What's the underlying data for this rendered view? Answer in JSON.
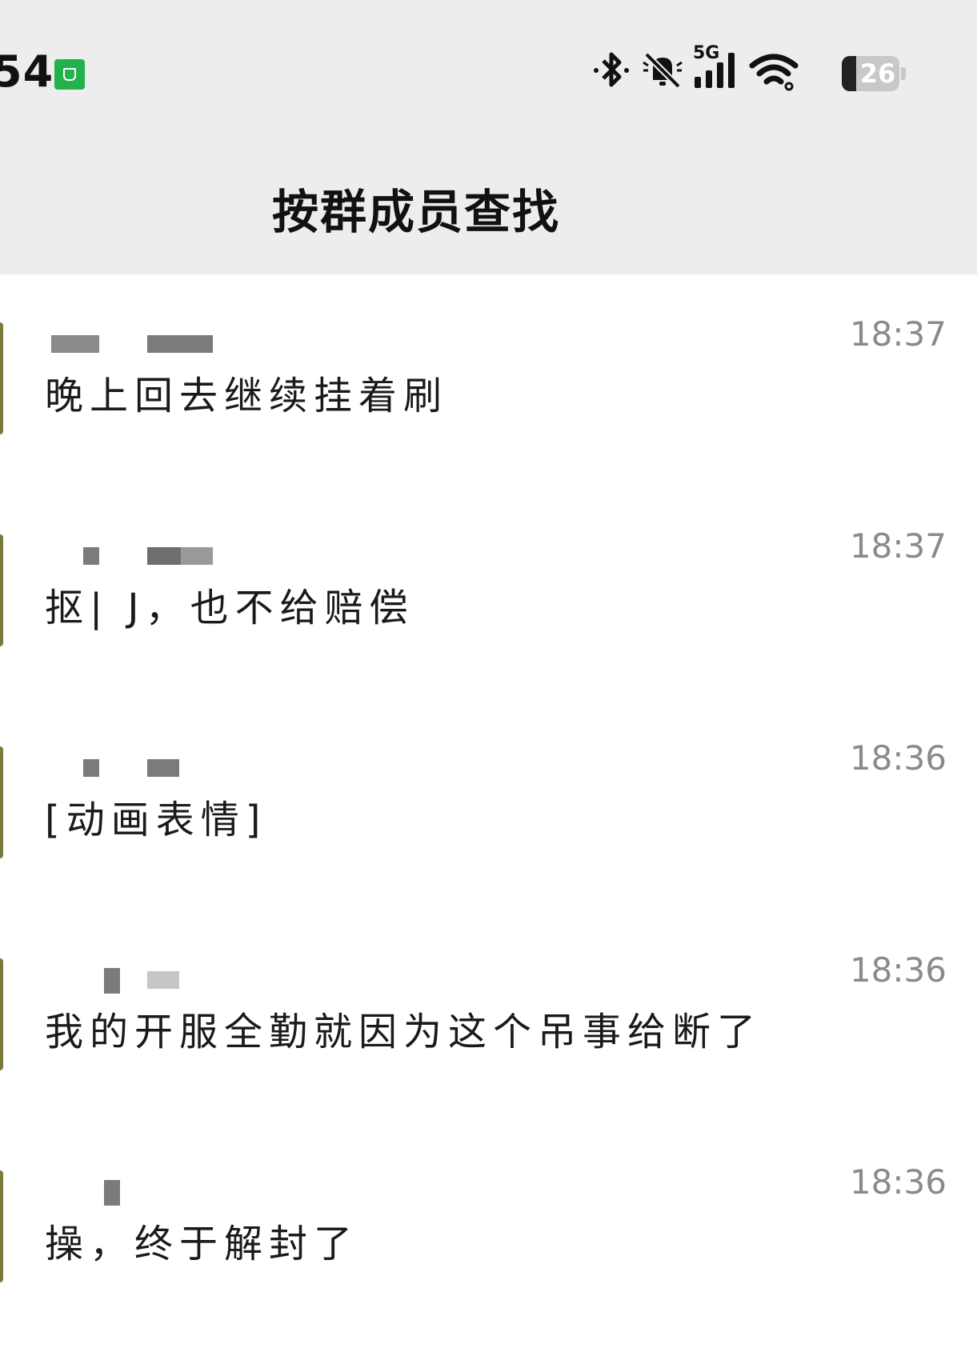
{
  "status_bar": {
    "time": "54",
    "network": "5G",
    "battery": "26",
    "icons": [
      "app-notification-icon",
      "bluetooth-icon",
      "mute-icon",
      "signal-icon",
      "wifi-icon",
      "battery-icon"
    ]
  },
  "header": {
    "title": "按群成员查找"
  },
  "messages": [
    {
      "text": "晚上回去继续挂着刷",
      "time": "18:37"
    },
    {
      "text": "抠| J，也不给赔偿",
      "time": "18:37"
    },
    {
      "text": "[动画表情]",
      "time": "18:36"
    },
    {
      "text": "我的开服全勤就因为这个吊事给断了",
      "time": "18:36"
    },
    {
      "text": "操，终于解封了",
      "time": "18:36"
    }
  ],
  "colors": {
    "header_bg": "#ededed",
    "time_text": "#8a8a8a",
    "message_text": "#1a1a1a"
  }
}
